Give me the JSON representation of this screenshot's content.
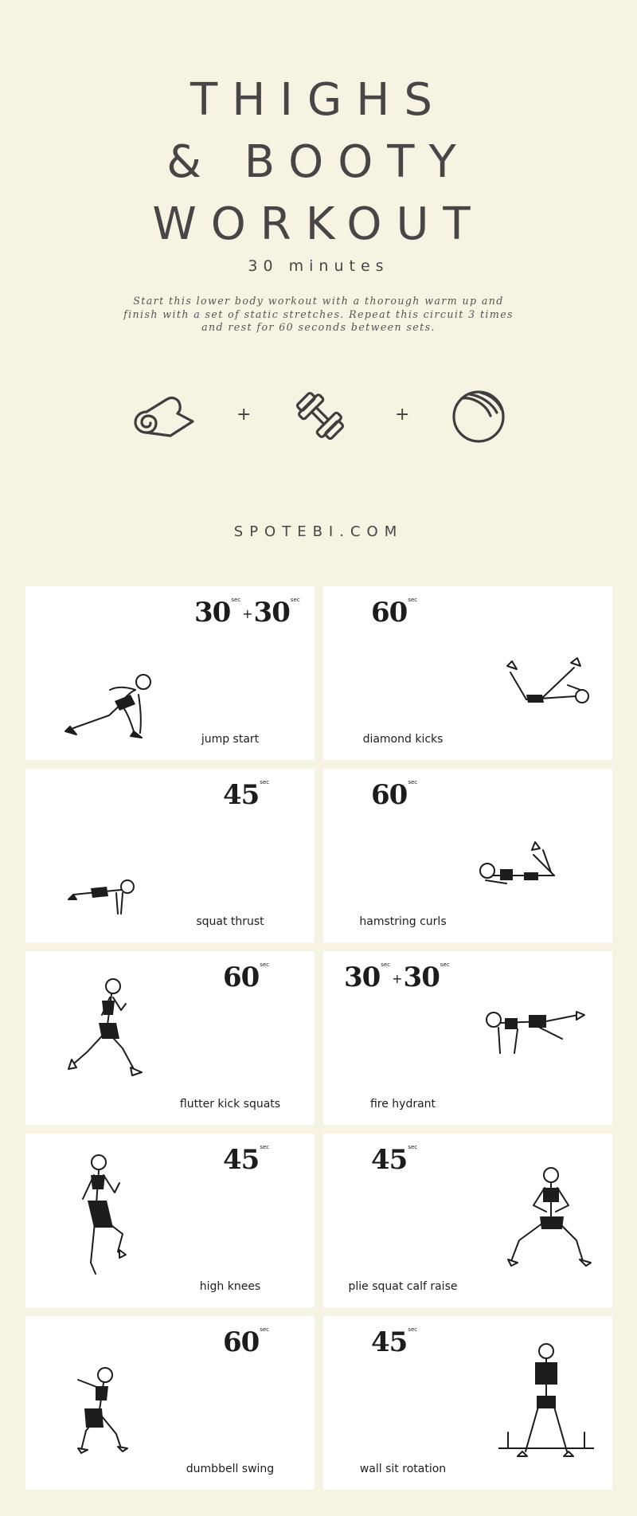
{
  "header": {
    "title_line1": "THIGHS",
    "title_line2": "& BOOTY",
    "title_line3": "WORKOUT",
    "duration": "30 minutes",
    "description": "Start this lower body workout with a thorough warm up and finish with a set of static stretches. Repeat this circuit 3 times and rest for 60 seconds between sets."
  },
  "equipment": {
    "items": [
      "yoga-mat-icon",
      "dumbbell-icon",
      "exercise-ball-icon"
    ],
    "separator": "+"
  },
  "brand": "SPOTEBI.COM",
  "time_unit": "sec",
  "exercises": [
    {
      "name": "jump start",
      "time_a": "30",
      "time_b": "30"
    },
    {
      "name": "diamond kicks",
      "time_a": "60"
    },
    {
      "name": "squat thrust",
      "time_a": "45"
    },
    {
      "name": "hamstring curls",
      "time_a": "60"
    },
    {
      "name": "flutter kick squats",
      "time_a": "60"
    },
    {
      "name": "fire hydrant",
      "time_a": "30",
      "time_b": "30"
    },
    {
      "name": "high knees",
      "time_a": "45"
    },
    {
      "name": "plie squat calf raise",
      "time_a": "45"
    },
    {
      "name": "dumbbell swing",
      "time_a": "60"
    },
    {
      "name": "wall sit rotation",
      "time_a": "45"
    }
  ]
}
